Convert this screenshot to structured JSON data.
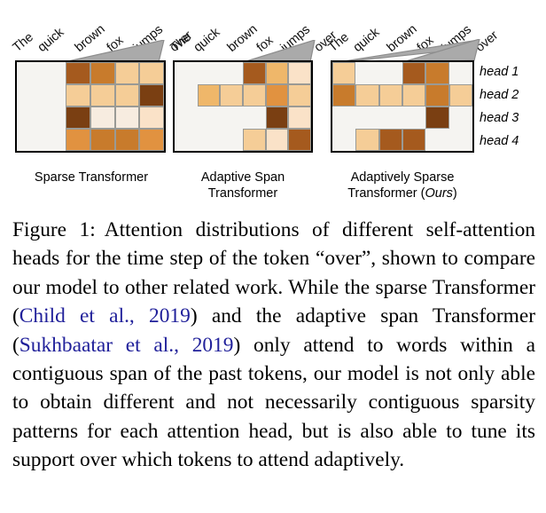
{
  "figure": {
    "tokens": [
      "The",
      "quick",
      "brown",
      "fox",
      "jumps",
      "over"
    ],
    "head_labels": [
      "head 1",
      "head 2",
      "head 3",
      "head 4"
    ],
    "panels": [
      {
        "id": "sparse-transformer",
        "caption_line1": "Sparse Transformer",
        "caption_line2": "",
        "caption_emph": ""
      },
      {
        "id": "adaptive-span-transformer",
        "caption_line1": "Adaptive Span",
        "caption_line2": "Transformer",
        "caption_emph": ""
      },
      {
        "id": "adaptively-sparse-transformer",
        "caption_line1": "Adaptively Sparse",
        "caption_line2": "Transformer (",
        "caption_emph": "Ours",
        "caption_line2_tail": ")"
      }
    ]
  },
  "colors": {
    "empty": "#f5f4f1",
    "gridline": "#9a9a95",
    "frame": "#000000",
    "cone": "#aaaaaa",
    "cone_stroke": "#8d8d8d",
    "citation": "#20209a",
    "palette": {
      "l0": "#f7ece0",
      "l1": "#fae2c8",
      "l2": "#f5cd97",
      "l3": "#efb76a",
      "l4": "#e19240",
      "l5": "#c87b2c",
      "l6": "#a55a1e",
      "l7": "#7a3f12"
    }
  },
  "chart_data": {
    "type": "heatmap",
    "title": "Attention distributions of different self-attention heads",
    "xlabel": "",
    "ylabel": "",
    "categories": [
      "The",
      "quick",
      "brown",
      "fox",
      "jumps",
      "over"
    ],
    "rows": [
      "head 1",
      "head 2",
      "head 3",
      "head 4"
    ],
    "legend_position": "none",
    "grid": true,
    "panels": [
      {
        "name": "Sparse Transformer",
        "cells": [
          [
            null,
            null,
            "#a55a1e",
            "#c87b2c",
            "#f5cd97",
            "#f5cd97"
          ],
          [
            null,
            null,
            "#f5cd97",
            "#f5cd97",
            "#f5cd97",
            "#7a3f12"
          ],
          [
            null,
            null,
            "#7a3f12",
            "#f7ece0",
            "#f7ece0",
            "#fae2c8"
          ],
          [
            null,
            null,
            "#e19240",
            "#c87b2c",
            "#c87b2c",
            "#e19240"
          ]
        ]
      },
      {
        "name": "Adaptive Span Transformer",
        "cells": [
          [
            null,
            null,
            null,
            "#a55a1e",
            "#efb76a",
            "#fae2c8"
          ],
          [
            null,
            "#efb76a",
            "#f5cd97",
            "#f5cd97",
            "#e19240",
            "#f5cd97"
          ],
          [
            null,
            null,
            null,
            null,
            "#7a3f12",
            "#fae2c8"
          ],
          [
            null,
            null,
            null,
            "#f5cd97",
            "#fae2c8",
            "#a55a1e"
          ]
        ]
      },
      {
        "name": "Adaptively Sparse Transformer (Ours)",
        "cells": [
          [
            "#f5cd97",
            null,
            null,
            "#a55a1e",
            "#c87b2c",
            null
          ],
          [
            "#c87b2c",
            "#f5cd97",
            "#f5cd97",
            "#f5cd97",
            "#c87b2c",
            "#f5cd97"
          ],
          [
            null,
            null,
            null,
            null,
            "#7a3f12",
            null
          ],
          [
            null,
            "#f5cd97",
            "#a55a1e",
            "#a55a1e",
            null,
            null
          ]
        ]
      }
    ]
  },
  "caption": {
    "label": "Figure 1:",
    "text": "Attention distributions of different self-attention heads for the time step of the token “over”, shown to compare our model to other related work. While the sparse Transformer (",
    "cite1": "Child et al., 2019",
    "text2": ") and the adaptive span Transformer (",
    "cite2": "Sukhbaatar et al., 2019",
    "text3": ") only attend to words within a contiguous span of the past tokens, our model is not only able to obtain different and not necessarily contiguous sparsity patterns for each attention head, but is also able to tune its support over which tokens to attend adaptively."
  }
}
